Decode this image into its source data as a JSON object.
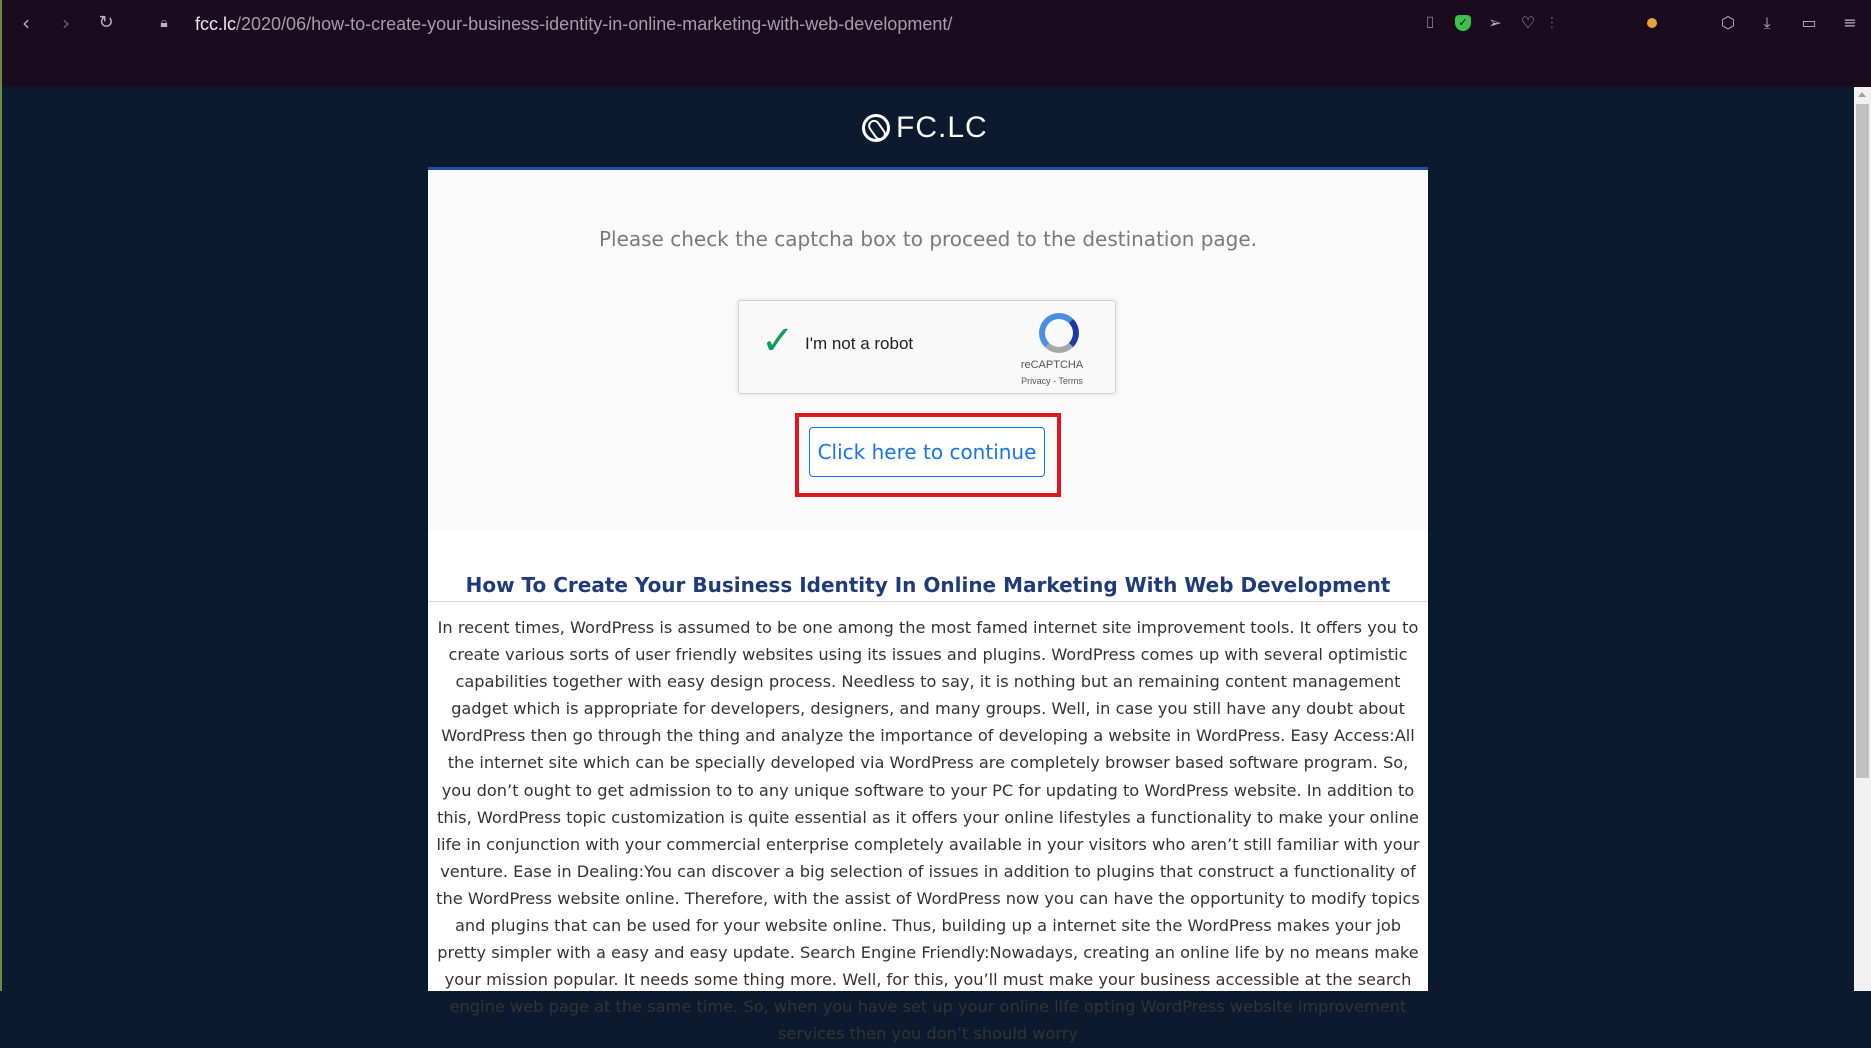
{
  "browser": {
    "url_domain": "fcc.lc",
    "url_path": "/2020/06/how-to-create-your-business-identity-in-online-marketing-with-web-development/",
    "icons": [
      "back-icon",
      "forward-icon",
      "reload-icon",
      "lock-icon",
      "camera-icon",
      "shield-icon",
      "send-icon",
      "heart-icon",
      "extension-icon",
      "cube-icon",
      "download-icon",
      "battery-icon",
      "menu-icon"
    ]
  },
  "site": {
    "logo_text": "FC.LC"
  },
  "captcha": {
    "instruction": "Please check the captcha box to proceed to the destination page.",
    "checkbox_label": "I'm not a robot",
    "brand": "reCAPTCHA",
    "links": "Privacy - Terms",
    "checked": true
  },
  "continue_button": {
    "label": "Click here to continue",
    "highlight_color": "#e0161e"
  },
  "article": {
    "title": "How To Create Your Business Identity In Online Marketing With Web Development",
    "body": "In recent times, WordPress is assumed to be one among the most famed internet site improvement tools. It offers you to create various sorts of user friendly websites using its issues and plugins. WordPress comes up with several optimistic capabilities together with easy design process. Needless to say, it is nothing but an remaining content management gadget which is appropriate for developers, designers, and many groups. Well, in case you still have any doubt about WordPress then go through the thing and analyze the importance of developing a website in WordPress. Easy Access:All the internet site which can be specially developed via WordPress are completely browser based software program. So, you don’t ought to get admission to to any unique software to your PC for updating to WordPress website. In addition to this, WordPress topic customization is quite essential as it offers your online lifestyles a functionality to make your online life in conjunction with your commercial enterprise completely available in your visitors who aren’t still familiar with your venture. Ease in Dealing:You can discover a big selection of issues in addition to plugins that construct a functionality of the WordPress website online. Therefore, with the assist of WordPress now you can have the opportunity to modify topics and plugins that can be used for your website online. Thus, building up a internet site the WordPress makes your job pretty simpler with a easy and easy update. Search Engine Friendly:Nowadays, creating an online life by no means make your mission popular. It needs some thing more. Well, for this, you’ll must make your business accessible at the search engine web page at the same time. So, when you have set up your online life opting WordPress website improvement services then you don’t should worry"
  },
  "colors": {
    "page_bg": "#0b1a2e",
    "chrome_bg": "#1b0b1f",
    "link_blue": "#1a73e8",
    "title_blue": "#1f3b78"
  }
}
